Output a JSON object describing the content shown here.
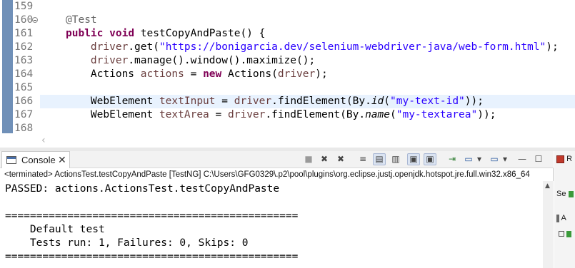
{
  "editor": {
    "lines": [
      {
        "num": "159",
        "tokens": []
      },
      {
        "num": "160",
        "tokens": [
          {
            "t": "@Test",
            "c": "ann"
          }
        ]
      },
      {
        "num": "161",
        "tokens": [
          {
            "t": "public",
            "c": "kw"
          },
          {
            "t": " ",
            "c": ""
          },
          {
            "t": "void",
            "c": "kw"
          },
          {
            "t": " testCopyAndPaste() {",
            "c": ""
          }
        ]
      },
      {
        "num": "162",
        "tokens": [
          {
            "t": "    ",
            "c": ""
          },
          {
            "t": "driver",
            "c": "fld"
          },
          {
            "t": ".get(",
            "c": ""
          },
          {
            "t": "\"https://bonigarcia.dev/selenium-webdriver-java/web-form.html\"",
            "c": "str"
          },
          {
            "t": ");",
            "c": ""
          }
        ]
      },
      {
        "num": "163",
        "tokens": [
          {
            "t": "    ",
            "c": ""
          },
          {
            "t": "driver",
            "c": "fld"
          },
          {
            "t": ".manage().window().maximize();",
            "c": ""
          }
        ]
      },
      {
        "num": "164",
        "tokens": [
          {
            "t": "    Actions ",
            "c": ""
          },
          {
            "t": "actions",
            "c": "fld"
          },
          {
            "t": " = ",
            "c": ""
          },
          {
            "t": "new",
            "c": "kw"
          },
          {
            "t": " Actions(",
            "c": ""
          },
          {
            "t": "driver",
            "c": "fld"
          },
          {
            "t": ");",
            "c": ""
          }
        ]
      },
      {
        "num": "165",
        "tokens": []
      },
      {
        "num": "166",
        "tokens": [
          {
            "t": "    WebElement ",
            "c": ""
          },
          {
            "t": "textInput",
            "c": "fld"
          },
          {
            "t": " = ",
            "c": ""
          },
          {
            "t": "driver",
            "c": "fld"
          },
          {
            "t": ".findElement(By.",
            "c": ""
          },
          {
            "t": "id",
            "c": "mth"
          },
          {
            "t": "(",
            "c": ""
          },
          {
            "t": "\"my-text-id\"",
            "c": "str"
          },
          {
            "t": "));",
            "c": ""
          }
        ]
      },
      {
        "num": "167",
        "tokens": [
          {
            "t": "    WebElement ",
            "c": ""
          },
          {
            "t": "textArea",
            "c": "fld"
          },
          {
            "t": " = ",
            "c": ""
          },
          {
            "t": "driver",
            "c": "fld"
          },
          {
            "t": ".findElement(By.",
            "c": ""
          },
          {
            "t": "name",
            "c": "mth"
          },
          {
            "t": "(",
            "c": ""
          },
          {
            "t": "\"my-textarea\"",
            "c": "str"
          },
          {
            "t": "));",
            "c": ""
          }
        ]
      },
      {
        "num": "168",
        "tokens": []
      }
    ]
  },
  "console": {
    "tab_label": "Console",
    "tab_close": "✕",
    "process_line": "<terminated> ActionsTest.testCopyAndPaste [TestNG] C:\\Users\\GFG0329\\.p2\\pool\\plugins\\org.eclipse.justj.openjdk.hotspot.jre.full.win32.x86_64",
    "toolbar_icons": [
      "■",
      "✖",
      "✖",
      "≡",
      "▤",
      "▥",
      "▣",
      "▣",
      "⇥",
      "▭",
      "▾",
      "▭",
      "▾",
      "—",
      "☐"
    ],
    "output": [
      "PASSED: actions.ActionsTest.testCopyAndPaste",
      "",
      "===============================================",
      "    Default test",
      "    Tests run: 1, Failures: 0, Skips: 0",
      "==============================================="
    ]
  },
  "right_panel": {
    "items": [
      "R",
      "Se",
      "A"
    ]
  }
}
